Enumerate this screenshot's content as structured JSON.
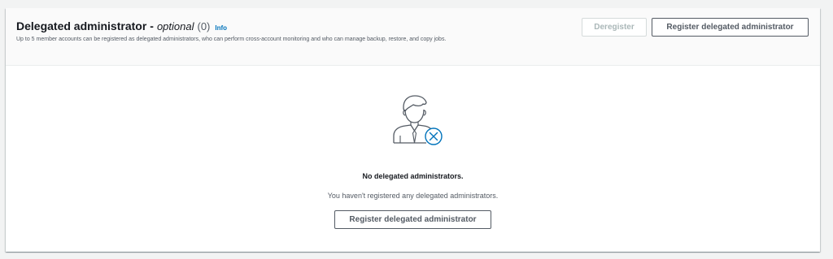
{
  "section": {
    "title": "Delegated administrator",
    "separator": "-",
    "optional_label": "optional",
    "count": "(0)",
    "info_link": "Info",
    "description": "Up to 5 member accounts can be registered as delegated administrators, who can perform cross-account monitoring and who can manage backup, restore, and copy jobs."
  },
  "actions": {
    "deregister_label": "Deregister",
    "deregister_disabled": true,
    "register_label": "Register delegated administrator"
  },
  "empty_state": {
    "icon": "user-remove-icon",
    "title": "No delegated administrators.",
    "description": "You haven't registered any delegated administrators.",
    "button_label": "Register delegated administrator"
  },
  "colors": {
    "link": "#0073bb",
    "icon_accent": "#0073bb",
    "icon_stroke": "#545b64",
    "disabled_text": "#aab7b8"
  }
}
